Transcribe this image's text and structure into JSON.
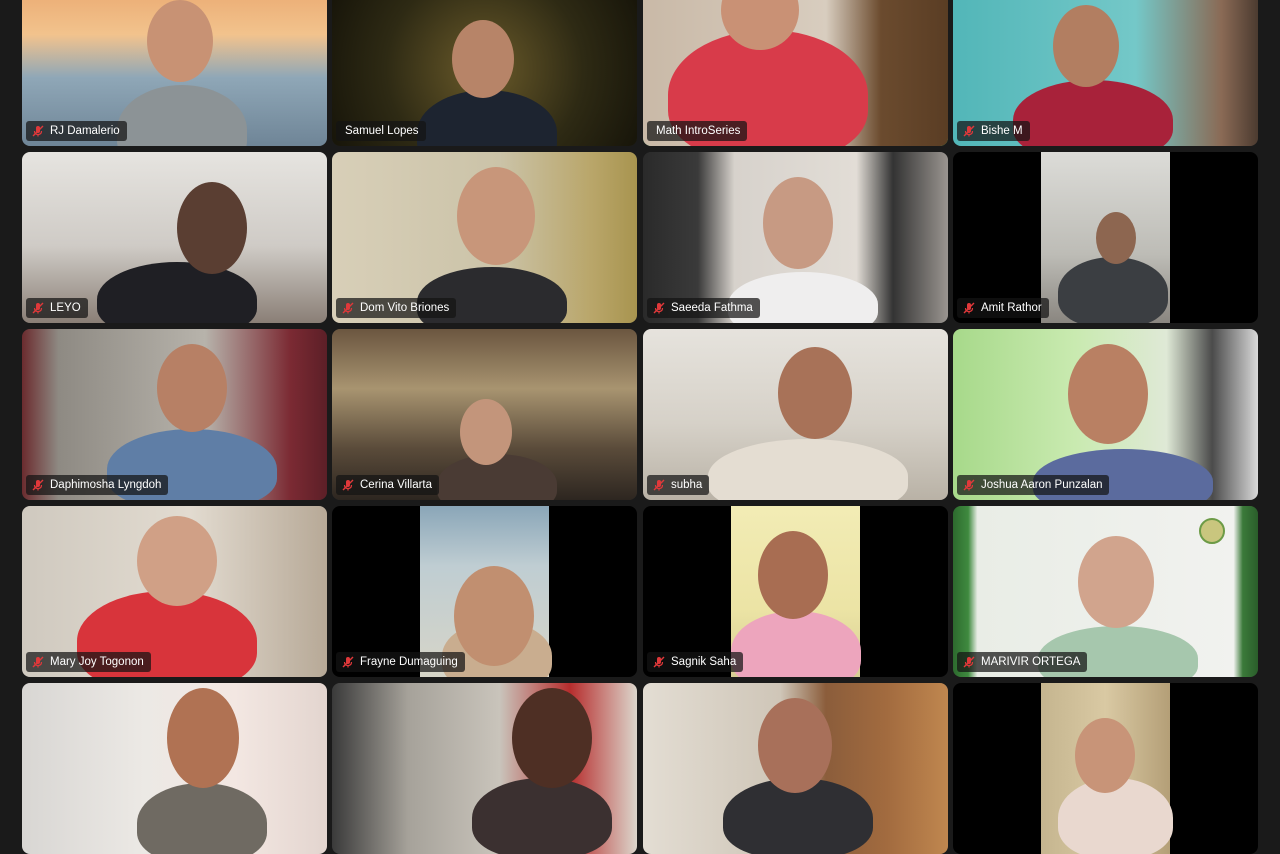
{
  "meeting": {
    "view": "gallery",
    "active_speaker_color": "#3fbf5a",
    "muted_icon": "microphone-muted-icon",
    "muted_icon_color": "#e0383a"
  },
  "participants": [
    {
      "name": "RJ Damalerio",
      "muted": true
    },
    {
      "name": "Samuel Lopes",
      "muted": false
    },
    {
      "name": "Math IntroSeries",
      "muted": false,
      "active_speaker": true
    },
    {
      "name": "Bishe M",
      "muted": true
    },
    {
      "name": "LEYO",
      "muted": true
    },
    {
      "name": "Dom Vito Briones",
      "muted": true
    },
    {
      "name": "Saeeda Fathma",
      "muted": true
    },
    {
      "name": "Amit Rathor",
      "muted": true
    },
    {
      "name": "Daphimosha Lyngdoh",
      "muted": true
    },
    {
      "name": "Cerina Villarta",
      "muted": true
    },
    {
      "name": "subha",
      "muted": true
    },
    {
      "name": "Joshua Aaron Punzalan",
      "muted": true
    },
    {
      "name": "Mary Joy Togonon",
      "muted": true
    },
    {
      "name": "Frayne Dumaguing",
      "muted": true
    },
    {
      "name": "Sagnik Saha",
      "muted": true
    },
    {
      "name": "MARIVIR ORTEGA",
      "muted": true
    },
    {
      "name": "",
      "muted": true
    },
    {
      "name": "",
      "muted": true
    },
    {
      "name": "",
      "muted": true
    },
    {
      "name": "",
      "muted": true
    }
  ]
}
